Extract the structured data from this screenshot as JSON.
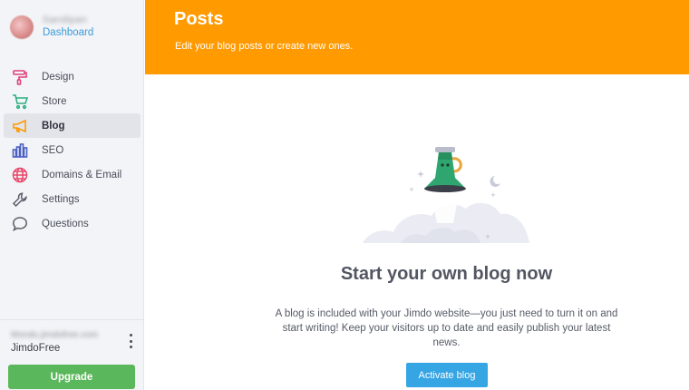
{
  "sidebar": {
    "profile": {
      "name": "Sandipan",
      "link_label": "Dashboard"
    },
    "items": [
      {
        "label": "Design",
        "icon": "paint-roller-icon",
        "active": false
      },
      {
        "label": "Store",
        "icon": "cart-icon",
        "active": false
      },
      {
        "label": "Blog",
        "icon": "megaphone-icon",
        "active": true
      },
      {
        "label": "SEO",
        "icon": "bar-chart-icon",
        "active": false
      },
      {
        "label": "Domains & Email",
        "icon": "globe-icon",
        "active": false
      },
      {
        "label": "Settings",
        "icon": "wrench-icon",
        "active": false
      },
      {
        "label": "Questions",
        "icon": "speech-bubble-icon",
        "active": false
      }
    ],
    "account": {
      "email": "Mondu.jimdofree.com",
      "plan": "JimdoFree"
    },
    "upgrade_label": "Upgrade"
  },
  "header": {
    "title": "Posts",
    "subtitle": "Edit your blog posts or create new ones."
  },
  "main": {
    "empty_title": "Start your own blog now",
    "empty_description": "A blog is included with your Jimdo website—you just need to turn it on and start writing! Keep your visitors up to date and easily publish your latest news.",
    "activate_label": "Activate blog",
    "illustration": "megaphone-launch-illustration"
  },
  "colors": {
    "header_bg": "#ff9a00",
    "upgrade_bg": "#5bb75b",
    "activate_bg": "#35a5e4",
    "link": "#3a9bd9",
    "sidebar_bg": "#f3f4f7"
  }
}
